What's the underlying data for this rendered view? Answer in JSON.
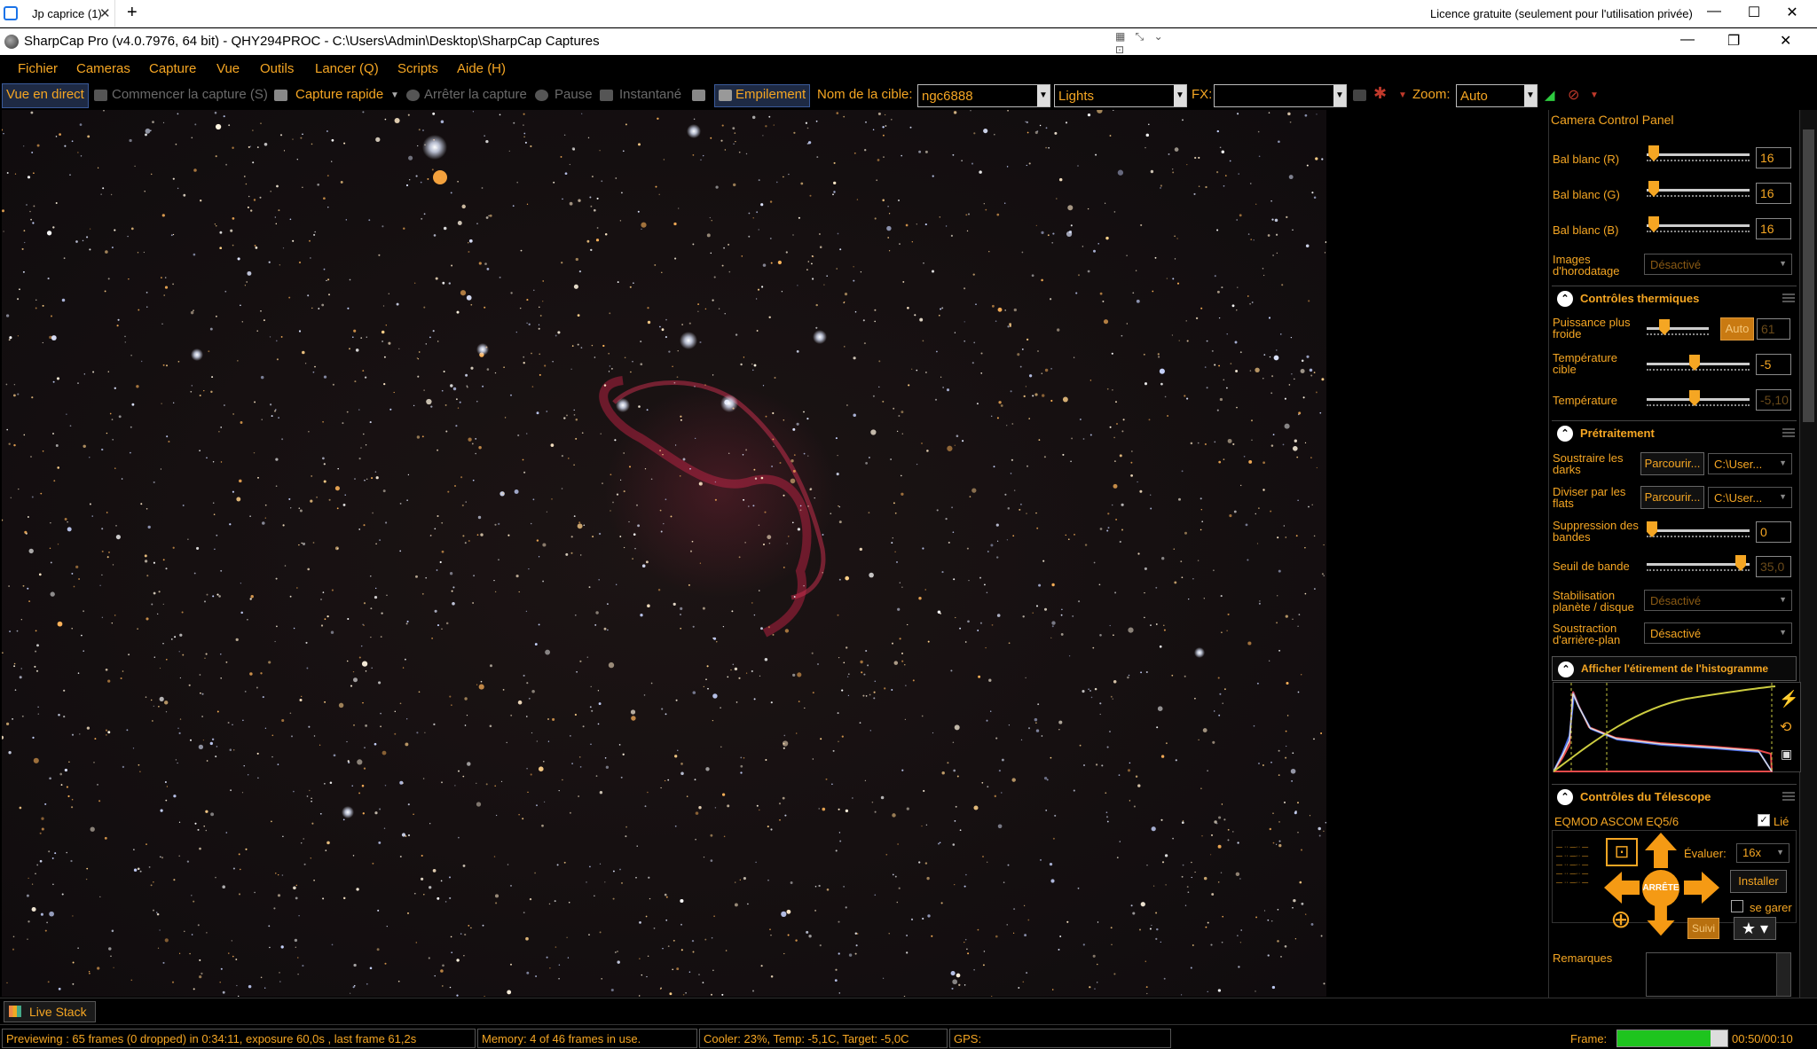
{
  "browser": {
    "tab_title": "Jp caprice (1)",
    "tab_close": "✕",
    "new_tab": "+",
    "license": "Licence gratuite (seulement pour l'utilisation privée)",
    "min": "—",
    "max": "☐",
    "close": "✕"
  },
  "app": {
    "title": "SharpCap Pro (v4.0.7976, 64 bit) - QHY294PROC - C:\\Users\\Admin\\Desktop\\SharpCap Captures",
    "min": "—",
    "restore": "❐",
    "close": "✕"
  },
  "menu": [
    "Fichier",
    "Cameras",
    "Capture",
    "Vue",
    "Outils",
    "Lancer (Q)",
    "Scripts",
    "Aide (H)"
  ],
  "toolbar": {
    "live_view": "Vue en direct",
    "start_capture": "Commencer la capture (S)",
    "quick_capture": "Capture rapide",
    "stop_capture": "Arrêter la capture",
    "pause": "Pause",
    "snapshot": "Instantané",
    "stacking": "Empilement",
    "target_label": "Nom de la cible:",
    "target_value": "ngc6888",
    "frame_type": "Lights",
    "fx_label": "FX:",
    "fx_value": "",
    "zoom_label": "Zoom:",
    "zoom_value": "Auto"
  },
  "panel": {
    "title": "Camera Control Panel",
    "wb_r_label": "Bal blanc (R)",
    "wb_r": "16",
    "wb_g_label": "Bal blanc (G)",
    "wb_g": "16",
    "wb_b_label": "Bal blanc (B)",
    "wb_b": "16",
    "timestamp_label": "Images d'horodatage",
    "timestamp_value": "Désactivé",
    "thermal_title": "Contrôles thermiques",
    "cooler_label": "Puissance plus froide",
    "cooler_auto": "Auto",
    "cooler_value": "61",
    "target_temp_label": "Température cible",
    "target_temp_value": "-5",
    "temp_label": "Température",
    "temp_value": "-5,10",
    "preproc_title": "Prétraitement",
    "darks_label": "Soustraire les darks",
    "darks_browse": "Parcourir...",
    "darks_path": "C:\\User...",
    "flats_label": "Diviser par les flats",
    "flats_browse": "Parcourir...",
    "flats_path": "C:\\User...",
    "banding_label": "Suppression des bandes",
    "banding_value": "0",
    "band_threshold_label": "Seuil de bande",
    "band_threshold_value": "35,0",
    "stabilization_label": "Stabilisation planète / disque",
    "stabilization_value": "Désactivé",
    "bg_sub_label": "Soustraction d'arrière-plan",
    "bg_sub_value": "Désactivé",
    "histogram_title": "Afficher l'étirement de l'histogramme",
    "telescope_title": "Contrôles du Télescope",
    "mount_name": "EQMOD ASCOM EQ5/6",
    "linked_label": "Lié",
    "rate_label": "Évaluer:",
    "rate_value": "16x",
    "install_btn": "Installer",
    "park_label": "se garer",
    "stop_btn": "ARRÊTE",
    "tracking_btn": "Suivi",
    "remarks_label": "Remarques"
  },
  "livestack": {
    "label": "Live Stack"
  },
  "status": {
    "preview": "Previewing : 65 frames (0 dropped) in 0:34:11, exposure 60,0s , last frame 61,2s",
    "memory": "Memory: 4 of 46 frames in use.",
    "cooler": "Cooler: 23%, Temp: -5,1C, Target: -5,0C",
    "gps": "GPS:",
    "frame_label": "Frame:",
    "frame_time": "00:50/00:10",
    "frame_progress": 0.85
  }
}
